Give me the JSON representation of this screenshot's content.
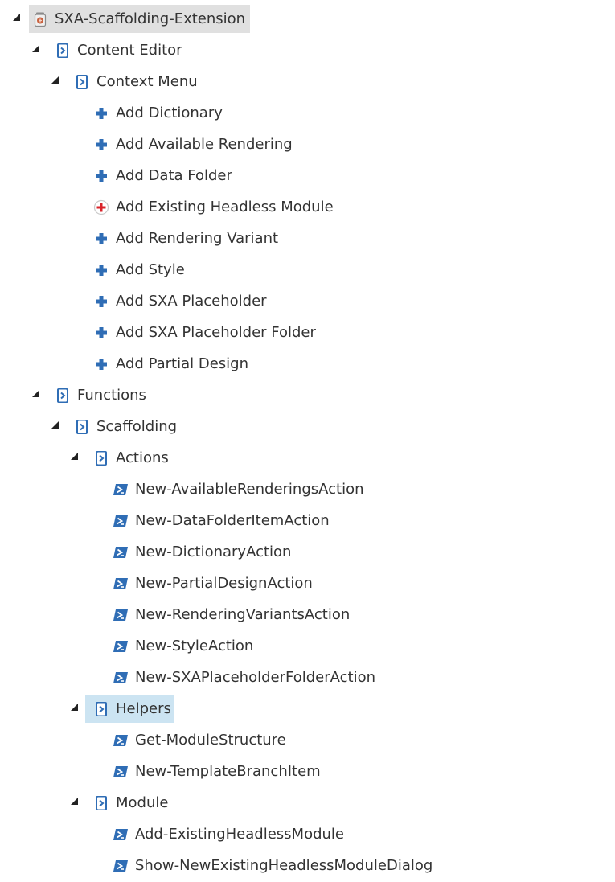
{
  "tree": {
    "root": {
      "label": "SXA-Scaffolding-Extension",
      "icon": "module-jar-icon"
    },
    "content_editor": {
      "label": "Content Editor",
      "icon": "powershell-library-icon"
    },
    "context_menu": {
      "label": "Context Menu",
      "icon": "powershell-library-icon"
    },
    "context_menu_items": [
      {
        "label": "Add Dictionary",
        "icon": "blue-plus-icon"
      },
      {
        "label": "Add Available Rendering",
        "icon": "blue-plus-icon"
      },
      {
        "label": "Add Data Folder",
        "icon": "blue-plus-icon"
      },
      {
        "label": "Add Existing Headless Module",
        "icon": "red-plus-circle-icon"
      },
      {
        "label": "Add Rendering Variant",
        "icon": "blue-plus-icon"
      },
      {
        "label": "Add Style",
        "icon": "blue-plus-icon"
      },
      {
        "label": "Add SXA Placeholder",
        "icon": "blue-plus-icon"
      },
      {
        "label": "Add SXA Placeholder Folder",
        "icon": "blue-plus-icon"
      },
      {
        "label": "Add Partial Design",
        "icon": "blue-plus-icon"
      }
    ],
    "functions": {
      "label": "Functions",
      "icon": "powershell-library-icon"
    },
    "scaffolding": {
      "label": "Scaffolding",
      "icon": "powershell-library-icon"
    },
    "actions": {
      "label": "Actions",
      "icon": "powershell-library-icon"
    },
    "actions_items": [
      {
        "label": "New-AvailableRenderingsAction",
        "icon": "powershell-script-icon"
      },
      {
        "label": "New-DataFolderItemAction",
        "icon": "powershell-script-icon"
      },
      {
        "label": "New-DictionaryAction",
        "icon": "powershell-script-icon"
      },
      {
        "label": "New-PartialDesignAction",
        "icon": "powershell-script-icon"
      },
      {
        "label": "New-RenderingVariantsAction",
        "icon": "powershell-script-icon"
      },
      {
        "label": "New-StyleAction",
        "icon": "powershell-script-icon"
      },
      {
        "label": "New-SXAPlaceholderFolderAction",
        "icon": "powershell-script-icon"
      }
    ],
    "helpers": {
      "label": "Helpers",
      "icon": "powershell-library-icon"
    },
    "helpers_items": [
      {
        "label": "Get-ModuleStructure",
        "icon": "powershell-script-icon"
      },
      {
        "label": "New-TemplateBranchItem",
        "icon": "powershell-script-icon"
      }
    ],
    "module": {
      "label": "Module",
      "icon": "powershell-library-icon"
    },
    "module_items": [
      {
        "label": "Add-ExistingHeadlessModule",
        "icon": "powershell-script-icon"
      },
      {
        "label": "Show-NewExistingHeadlessModuleDialog",
        "icon": "powershell-script-icon"
      }
    ]
  },
  "colors": {
    "selected_bg": "#e0e0e0",
    "hover_bg": "#cce4f2",
    "icon_blue": "#2f6db5",
    "plus_red": "#d9232a",
    "text": "#333333"
  }
}
